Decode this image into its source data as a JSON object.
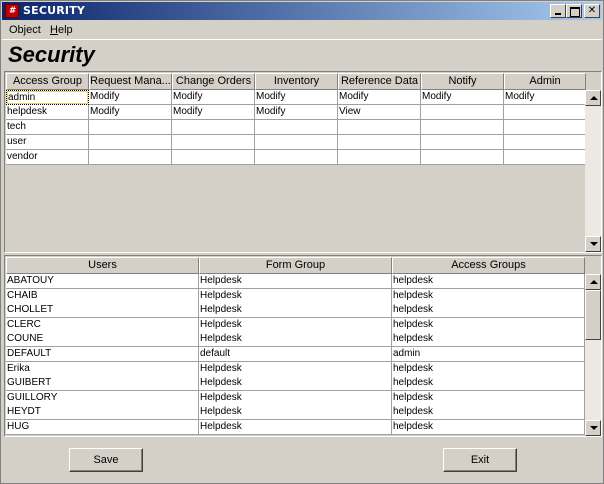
{
  "window": {
    "title": "SECURITY",
    "icon_glyph": "#"
  },
  "menu": {
    "object": "Object",
    "help": "Help"
  },
  "page_title": "Security",
  "access_grid": {
    "columns": [
      "Access Group",
      "Request Mana...",
      "Change Orders",
      "Inventory",
      "Reference Data",
      "Notify",
      "Admin"
    ],
    "rows": [
      [
        "admin",
        "Modify",
        "Modify",
        "Modify",
        "Modify",
        "Modify",
        "Modify"
      ],
      [
        "helpdesk",
        "Modify",
        "Modify",
        "Modify",
        "View",
        "",
        ""
      ],
      [
        "tech",
        "",
        "",
        "",
        "",
        "",
        ""
      ],
      [
        "user",
        "",
        "",
        "",
        "",
        "",
        ""
      ],
      [
        "vendor",
        "",
        "",
        "",
        "",
        "",
        ""
      ]
    ]
  },
  "users_grid": {
    "columns": [
      "Users",
      "Form Group",
      "Access Groups"
    ],
    "rows": [
      [
        "ABATOUY",
        "Helpdesk",
        "helpdesk"
      ],
      [
        "CHAIB",
        "Helpdesk",
        "helpdesk"
      ],
      [
        "CHOLLET",
        "Helpdesk",
        "helpdesk"
      ],
      [
        "CLERC",
        "Helpdesk",
        "helpdesk"
      ],
      [
        "COUNE",
        "Helpdesk",
        "helpdesk"
      ],
      [
        "DEFAULT",
        "default",
        "admin"
      ],
      [
        "Erika",
        "Helpdesk",
        "helpdesk"
      ],
      [
        "GUIBERT",
        "Helpdesk",
        "helpdesk"
      ],
      [
        "GUILLORY",
        "Helpdesk",
        "helpdesk"
      ],
      [
        "HEYDT",
        "Helpdesk",
        "helpdesk"
      ],
      [
        "HUG",
        "Helpdesk",
        "helpdesk"
      ]
    ]
  },
  "buttons": {
    "save": "Save",
    "exit": "Exit"
  }
}
